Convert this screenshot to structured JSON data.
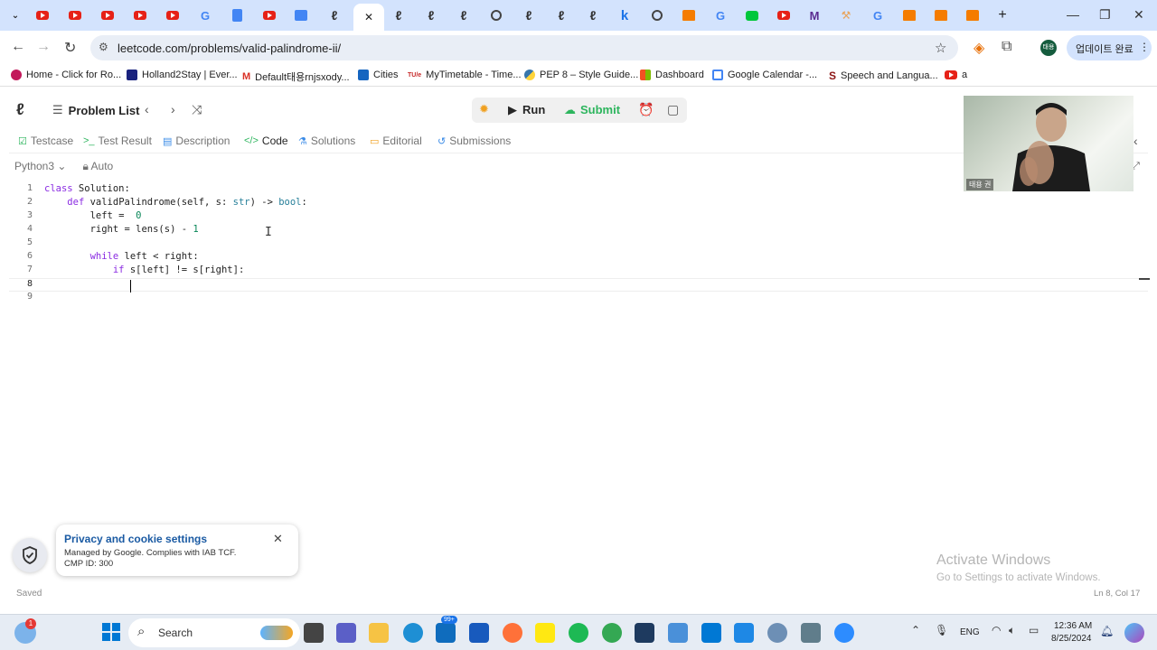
{
  "browser": {
    "tabs_bar": {
      "new_tab": "+",
      "minimize": "—",
      "restore": "❐",
      "close": "✕"
    },
    "url": "leetcode.com/problems/valid-palindrome-ii/",
    "update_button": "업데이트 완료",
    "profile_initials": "태용",
    "bookmarks": [
      "Home - Click for Ro...",
      "Holland2Stay | Ever...",
      "Default태용rnjsxody...",
      "Cities",
      "MyTimetable - Time...",
      "PEP 8 – Style Guide...",
      "Dashboard",
      "Google Calendar -...",
      "Speech and Langua...",
      "a"
    ]
  },
  "leetcode": {
    "problem_list": "Problem List",
    "run": "Run",
    "submit": "Submit",
    "tabs": [
      {
        "label": "Testcase",
        "icon": "check-square-icon"
      },
      {
        "label": "Test Result",
        "icon": "terminal-icon"
      },
      {
        "label": "Description",
        "icon": "document-icon"
      },
      {
        "label": "Code",
        "icon": "code-icon"
      },
      {
        "label": "Solutions",
        "icon": "flask-icon"
      },
      {
        "label": "Editorial",
        "icon": "book-icon"
      },
      {
        "label": "Submissions",
        "icon": "history-icon"
      }
    ],
    "language": "Python3",
    "autosave": "Auto",
    "code_lines": [
      "class Solution:",
      "    def validPalindrome(self, s: str) -> bool:",
      "        left =  0",
      "        right = lens(s) - 1",
      "",
      "        while left < right:",
      "            if s[left] != s[right]:",
      "",
      ""
    ],
    "status_saved": "Saved",
    "cursor_position": "Ln 8, Col 17"
  },
  "webcam": {
    "name": "태용 권"
  },
  "privacy_popup": {
    "title": "Privacy and cookie settings",
    "line1": "Managed by Google. Complies with IAB TCF.",
    "line2": "CMP ID: 300"
  },
  "watermark": {
    "line1": "Activate Windows",
    "line2": "Go to Settings to activate Windows."
  },
  "taskbar": {
    "search": "Search",
    "weather_badge": "1",
    "mail_badge": "99+",
    "lang": "ENG",
    "time": "12:36 AM",
    "date": "8/25/2024"
  },
  "colors": {
    "tabstrip": "#d3e3fd",
    "submit_green": "#2db55d",
    "keyword": "#8a2be2",
    "privacy_title": "#1a5aa3"
  }
}
